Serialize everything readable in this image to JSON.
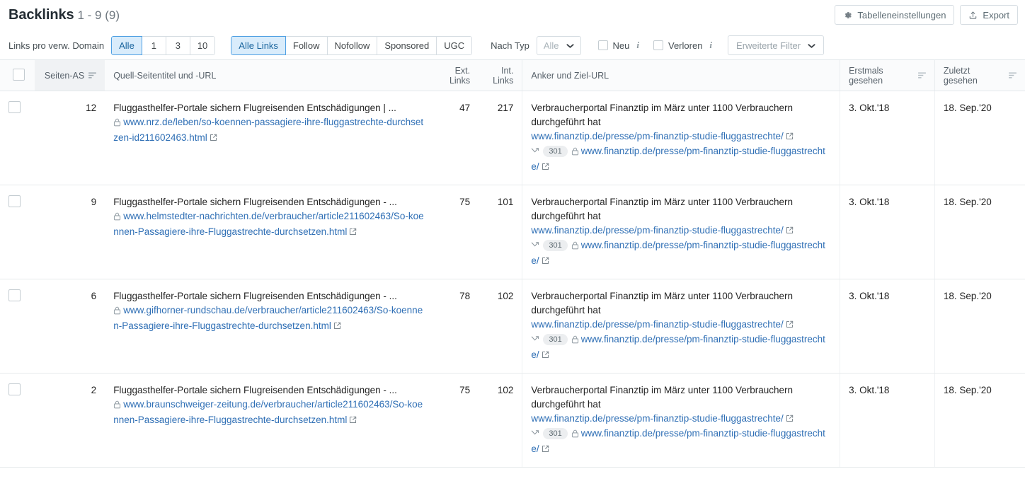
{
  "header": {
    "title": "Backlinks",
    "count_range": "1 - 9 (9)",
    "settings_button": "Tabelleneinstellungen",
    "export_button": "Export"
  },
  "filters": {
    "links_per_domain_label": "Links pro verw. Domain",
    "links_per_domain_options": [
      "Alle",
      "1",
      "3",
      "10"
    ],
    "links_per_domain_active": "Alle",
    "link_type_options": [
      "Alle Links",
      "Follow",
      "Nofollow",
      "Sponsored",
      "UGC"
    ],
    "link_type_active": "Alle Links",
    "by_type_label": "Nach Typ",
    "by_type_value": "Alle",
    "new_label": "Neu",
    "lost_label": "Verloren",
    "advanced_filter_label": "Erweiterte Filter"
  },
  "table": {
    "columns": {
      "page_as": "Seiten-AS",
      "source": "Quell-Seitentitel und -URL",
      "ext_links": "Ext. Links",
      "int_links": "Int. Links",
      "anchor": "Anker und Ziel-URL",
      "first_seen": "Erstmals gesehen",
      "last_seen": "Zuletzt gesehen"
    },
    "rows": [
      {
        "page_as": "12",
        "source_title": "Fluggasthelfer-Portale sichern Flugreisenden Entschädigungen | ...",
        "source_url": "www.nrz.de/leben/so-koennen-passagiere-ihre-fluggastrechte-durchsetzen-id211602463.html",
        "ext_links": "47",
        "int_links": "217",
        "anchor_text": "Verbraucherportal Finanztip im März unter 1100 Verbrauchern durchgeführt hat",
        "target_url": "www.finanztip.de/presse/pm-finanztip-studie-fluggastrechte/",
        "redirect_code": "301",
        "redirect_url": "www.finanztip.de/presse/pm-finanztip-studie-fluggastrechte/",
        "first_seen": "3. Okt.'18",
        "last_seen": "18. Sep.'20"
      },
      {
        "page_as": "9",
        "source_title": "Fluggasthelfer-Portale sichern Flugreisenden Entschädigungen - ...",
        "source_url": "www.helmstedter-nachrichten.de/verbraucher/article211602463/So-koennen-Passagiere-ihre-Fluggastrechte-durchsetzen.html",
        "ext_links": "75",
        "int_links": "101",
        "anchor_text": "Verbraucherportal Finanztip im März unter 1100 Verbrauchern durchgeführt hat",
        "target_url": "www.finanztip.de/presse/pm-finanztip-studie-fluggastrechte/",
        "redirect_code": "301",
        "redirect_url": "www.finanztip.de/presse/pm-finanztip-studie-fluggastrechte/",
        "first_seen": "3. Okt.'18",
        "last_seen": "18. Sep.'20"
      },
      {
        "page_as": "6",
        "source_title": "Fluggasthelfer-Portale sichern Flugreisenden Entschädigungen - ...",
        "source_url": "www.gifhorner-rundschau.de/verbraucher/article211602463/So-koennen-Passagiere-ihre-Fluggastrechte-durchsetzen.html",
        "ext_links": "78",
        "int_links": "102",
        "anchor_text": "Verbraucherportal Finanztip im März unter 1100 Verbrauchern durchgeführt hat",
        "target_url": "www.finanztip.de/presse/pm-finanztip-studie-fluggastrechte/",
        "redirect_code": "301",
        "redirect_url": "www.finanztip.de/presse/pm-finanztip-studie-fluggastrechte/",
        "first_seen": "3. Okt.'18",
        "last_seen": "18. Sep.'20"
      },
      {
        "page_as": "2",
        "source_title": "Fluggasthelfer-Portale sichern Flugreisenden Entschädigungen - ...",
        "source_url": "www.braunschweiger-zeitung.de/verbraucher/article211602463/So-koennen-Passagiere-ihre-Fluggastrechte-durchsetzen.html",
        "ext_links": "75",
        "int_links": "102",
        "anchor_text": "Verbraucherportal Finanztip im März unter 1100 Verbrauchern durchgeführt hat",
        "target_url": "www.finanztip.de/presse/pm-finanztip-studie-fluggastrechte/",
        "redirect_code": "301",
        "redirect_url": "www.finanztip.de/presse/pm-finanztip-studie-fluggastrechte/",
        "first_seen": "3. Okt.'18",
        "last_seen": "18. Sep.'20"
      }
    ]
  },
  "colors": {
    "link": "#2f6fb5",
    "active_filter_bg": "#d9ecfb",
    "active_filter_border": "#4fa0e3",
    "text": "#242424",
    "muted": "#6c757d"
  }
}
